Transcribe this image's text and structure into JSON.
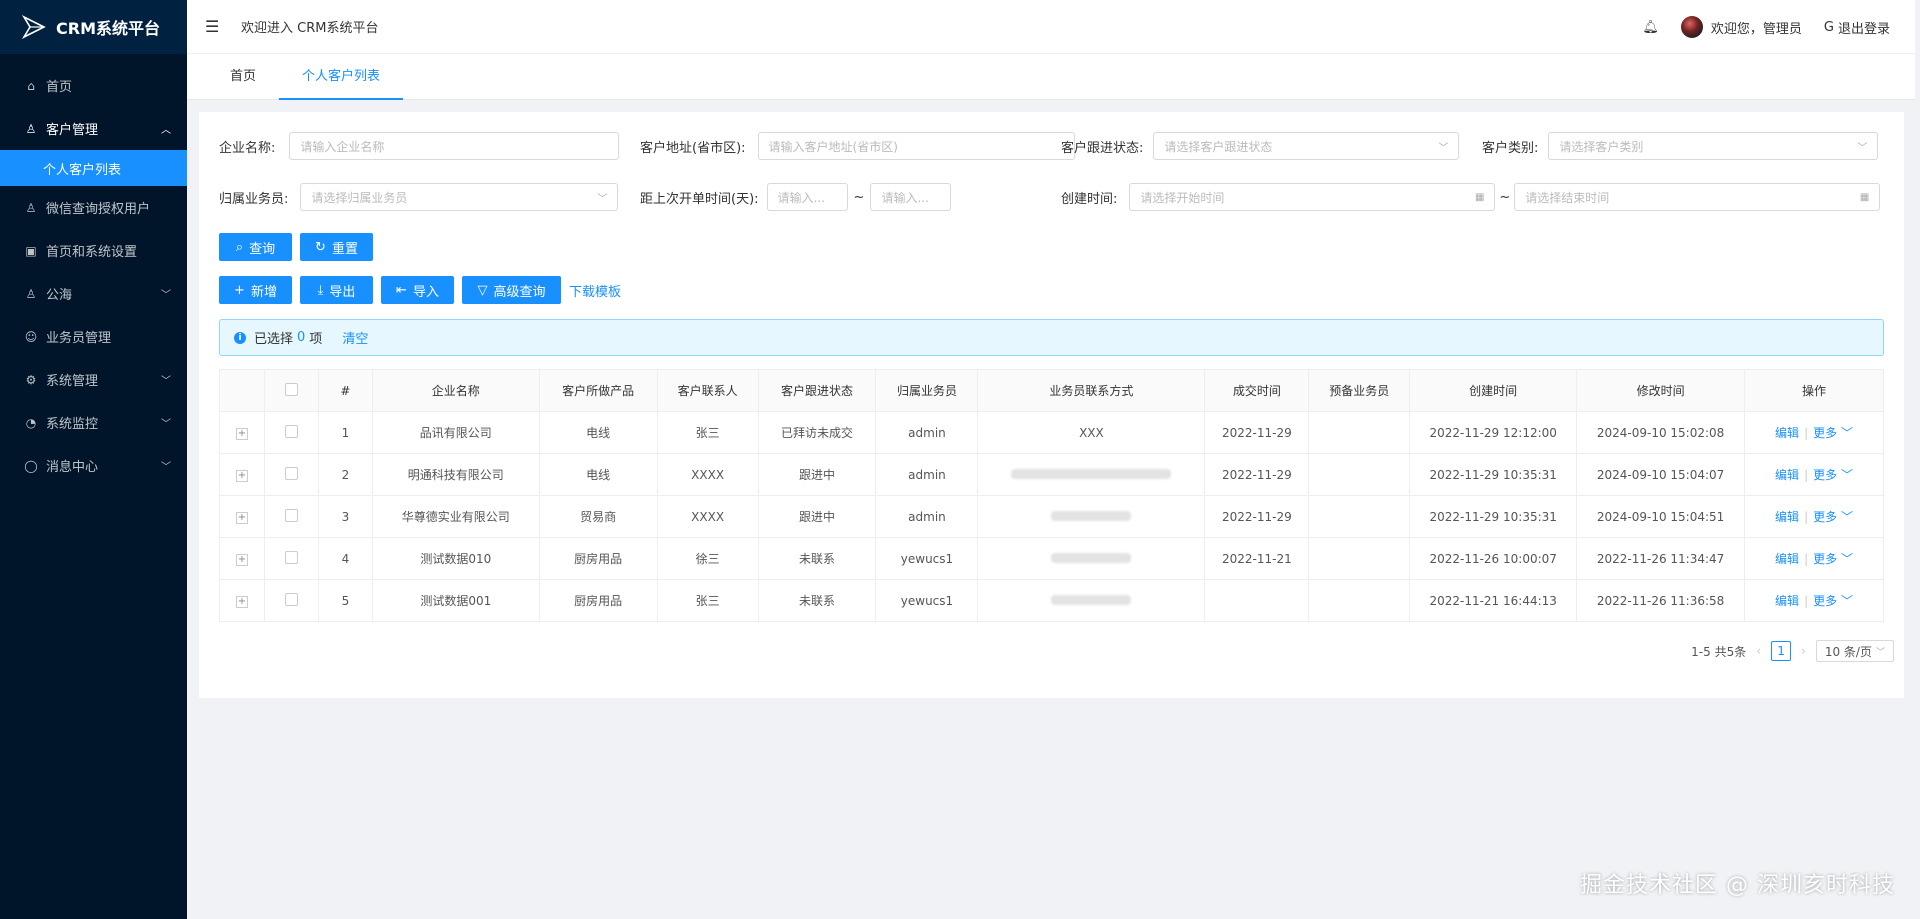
{
  "app": {
    "logo_text": "CRM系统平台"
  },
  "sidebar": {
    "items": [
      {
        "label": "首页",
        "icon": "home-icon"
      },
      {
        "label": "客户管理",
        "icon": "customer-icon"
      },
      {
        "label": "个人客户列表"
      },
      {
        "label": "微信查询授权用户",
        "icon": "wechat-user-icon"
      },
      {
        "label": "首页和系统设置",
        "icon": "image-icon"
      },
      {
        "label": "公海",
        "icon": "sea-icon"
      },
      {
        "label": "业务员管理",
        "icon": "staff-icon"
      },
      {
        "label": "系统管理",
        "icon": "gear-icon"
      },
      {
        "label": "系统监控",
        "icon": "monitor-icon"
      },
      {
        "label": "消息中心",
        "icon": "message-icon"
      }
    ]
  },
  "header": {
    "title": "欢迎进入 CRM系统平台",
    "greeting": "欢迎您，管理员",
    "logout": "退出登录"
  },
  "tabs": [
    {
      "label": "首页"
    },
    {
      "label": "个人客户列表"
    }
  ],
  "filters": {
    "company_name": {
      "label": "企业名称:",
      "placeholder": "请输入企业名称"
    },
    "address": {
      "label": "客户地址(省市区):",
      "placeholder": "请输入客户地址(省市区)"
    },
    "follow_status": {
      "label": "客户跟进状态:",
      "placeholder": "请选择客户跟进状态"
    },
    "category": {
      "label": "客户类别:",
      "placeholder": "请选择客户类别"
    },
    "salesman": {
      "label": "归属业务员:",
      "placeholder": "请选择归属业务员"
    },
    "days_since": {
      "label": "距上次开单时间(天):",
      "placeholder_from": "请输入...",
      "placeholder_to": "请输入...",
      "sep": "~"
    },
    "created": {
      "label": "创建时间:",
      "placeholder_start": "请选择开始时间",
      "placeholder_end": "请选择结束时间",
      "sep": "~"
    }
  },
  "buttons": {
    "query": "查询",
    "reset": "重置",
    "add": "新增",
    "export": "导出",
    "import": "导入",
    "advanced": "高级查询",
    "download_template": "下载模板"
  },
  "selection": {
    "prefix": "已选择",
    "count": "0",
    "suffix": "项",
    "clear": "清空"
  },
  "table": {
    "columns": [
      "#",
      "企业名称",
      "客户所做产品",
      "客户联系人",
      "客户跟进状态",
      "归属业务员",
      "业务员联系方式",
      "成交时间",
      "预备业务员",
      "创建时间",
      "修改时间",
      "操作"
    ],
    "rows": [
      {
        "idx": "1",
        "company": "品讯有限公司",
        "product": "电线",
        "contact": "张三",
        "status": "已拜访未成交",
        "salesman": "admin",
        "phone": "XXX",
        "deal": "2022-11-29",
        "reserve": "",
        "created": "2022-11-29 12:12:00",
        "modified": "2024-09-10 15:02:08"
      },
      {
        "idx": "2",
        "company": "明通科技有限公司",
        "product": "电线",
        "contact": "XXXX",
        "status": "跟进中",
        "salesman": "admin",
        "phone": "",
        "deal": "2022-11-29",
        "reserve": "",
        "created": "2022-11-29 10:35:31",
        "modified": "2024-09-10 15:04:07"
      },
      {
        "idx": "3",
        "company": "华尊德实业有限公司",
        "product": "贸易商",
        "contact": "XXXX",
        "status": "跟进中",
        "salesman": "admin",
        "phone": "",
        "deal": "2022-11-29",
        "reserve": "",
        "created": "2022-11-29 10:35:31",
        "modified": "2024-09-10 15:04:51"
      },
      {
        "idx": "4",
        "company": "测试数据010",
        "product": "厨房用品",
        "contact": "徐三",
        "status": "未联系",
        "salesman": "yewucs1",
        "phone": "",
        "deal": "2022-11-21",
        "reserve": "",
        "created": "2022-11-26 10:00:07",
        "modified": "2022-11-26 11:34:47"
      },
      {
        "idx": "5",
        "company": "测试数据001",
        "product": "厨房用品",
        "contact": "张三",
        "status": "未联系",
        "salesman": "yewucs1",
        "phone": "",
        "deal": "",
        "reserve": "",
        "created": "2022-11-21 16:44:13",
        "modified": "2022-11-26 11:36:58"
      }
    ],
    "op_edit": "编辑",
    "op_more": "更多"
  },
  "pagination": {
    "total": "1-5 共5条",
    "current": "1",
    "page_size": "10 条/页"
  },
  "watermark": "掘金技术社区 @ 深圳亥时科技"
}
